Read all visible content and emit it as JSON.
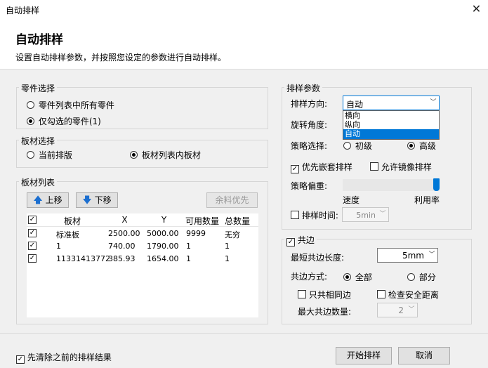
{
  "window": {
    "title": "自动排样"
  },
  "header": {
    "title": "自动排样",
    "description": "设置自动排样参数，并按照您设定的参数进行自动排样。"
  },
  "parts_group": {
    "label": "零件选择",
    "option_all": "零件列表中所有零件",
    "option_checked": "仅勾选的零件(1)",
    "selected": "仅勾选的零件(1)"
  },
  "sheet_group": {
    "label": "板材选择",
    "option_current": "当前排版",
    "option_list": "板材列表内板材",
    "selected": "板材列表内板材"
  },
  "sheet_list": {
    "label": "板材列表",
    "up_button": "上移",
    "down_button": "下移",
    "remnant_button": "余料优先",
    "columns": [
      "板材",
      "X",
      "Y",
      "可用数量",
      "总数量"
    ],
    "rows": [
      {
        "checked": true,
        "name": "标准板",
        "x": "2500.00",
        "y": "5000.00",
        "avail": "9999",
        "total": "无穷"
      },
      {
        "checked": true,
        "name": "1",
        "x": "740.00",
        "y": "1790.00",
        "avail": "1",
        "total": "1"
      },
      {
        "checked": true,
        "name": "11331413772",
        "x": "385.93",
        "y": "1654.00",
        "avail": "1",
        "total": "1"
      }
    ]
  },
  "nesting_params": {
    "label": "排样参数",
    "direction_label": "排样方向:",
    "direction_value": "自动",
    "direction_options": [
      "横向",
      "纵向",
      "自动"
    ],
    "rotation_label": "旋转角度:",
    "strategy_label": "策略选择:",
    "strategy_basic": "初级",
    "strategy_advanced": "高级",
    "strategy_selected": "高级",
    "priority_nest_label": "优先嵌套排样",
    "priority_nest_checked": true,
    "allow_mirror_label": "允许镜像排样",
    "allow_mirror_checked": false,
    "bias_label": "策略偏重:",
    "bias_left": "速度",
    "bias_right": "利用率",
    "bias_value": 1.0,
    "time_label": "排样时间:",
    "time_checked": false,
    "time_value": "5min"
  },
  "common_edge": {
    "label": "共边",
    "checked": true,
    "min_length_label": "最短共边长度:",
    "min_length_value": "5mm",
    "mode_label": "共边方式:",
    "mode_all": "全部",
    "mode_partial": "部分",
    "mode_selected": "全部",
    "same_only_label": "只共相同边",
    "same_only_checked": false,
    "check_safe_label": "检查安全距离",
    "check_safe_checked": false,
    "max_count_label": "最大共边数量:",
    "max_count_value": "2"
  },
  "footer": {
    "clear_label": "先清除之前的排样结果",
    "clear_checked": true,
    "start_button": "开始排样",
    "cancel_button": "取消"
  },
  "colors": {
    "accent": "#0078d7",
    "selection": "#0078d7",
    "up_arrow": "#1c6fd0"
  }
}
